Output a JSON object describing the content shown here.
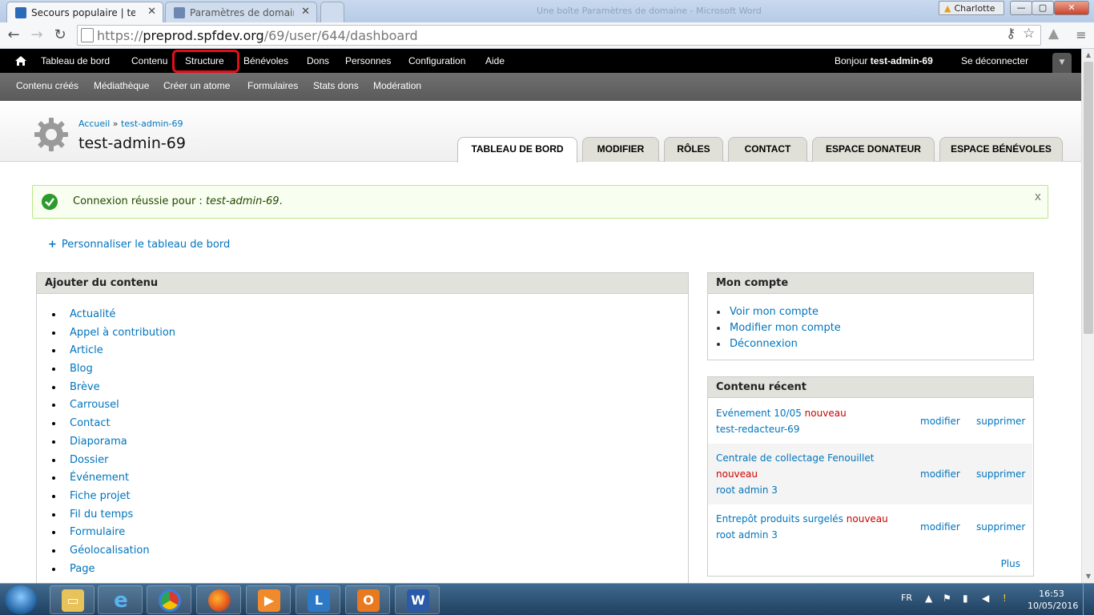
{
  "browser": {
    "tabs": [
      {
        "title": "Secours populaire | test-a",
        "active": true
      },
      {
        "title": "Paramètres de domaine",
        "active": false
      }
    ],
    "window_title_faded": "Une boîte Paramètres de domaine - Microsoft Word",
    "profile_name": "Charlotte",
    "window_buttons": {
      "minimize": "—",
      "maximize": "▢",
      "close": "✕"
    },
    "url": {
      "scheme": "https://",
      "host": "preprod.spfdev.org",
      "path": "/69/user/644/dashboard"
    },
    "nav": {
      "back": "←",
      "forward": "→",
      "reload": "↻"
    }
  },
  "admin_toolbar": {
    "items": [
      "Tableau de bord",
      "Contenu",
      "Structure",
      "Bénévoles",
      "Dons",
      "Personnes",
      "Configuration",
      "Aide"
    ],
    "highlighted": "Structure",
    "greeting_prefix": "Bonjour",
    "username": "test-admin-69",
    "logout": "Se déconnecter"
  },
  "shortcuts": [
    "Contenu créés",
    "Médiathèque",
    "Créer un atome",
    "Formulaires",
    "Stats dons",
    "Modération"
  ],
  "header": {
    "breadcrumb": {
      "home": "Accueil",
      "separator": "»",
      "current": "test-admin-69"
    },
    "title": "test-admin-69",
    "tabs": [
      "Tableau de bord",
      "Modifier",
      "Rôles",
      "Contact",
      "Espace donateur",
      "Espace bénévoles"
    ],
    "active_tab": "Tableau de bord"
  },
  "message": {
    "text": "Connexion réussie pour : ",
    "user": "test-admin-69",
    "end": ".",
    "close": "x"
  },
  "personalize": {
    "icon": "+",
    "label": "Personnaliser le tableau de bord"
  },
  "add_content": {
    "title": "Ajouter du contenu",
    "items": [
      "Actualité",
      "Appel à contribution",
      "Article",
      "Blog",
      "Brève",
      "Carrousel",
      "Contact",
      "Diaporama",
      "Dossier",
      "Événement",
      "Fiche projet",
      "Fil du temps",
      "Formulaire",
      "Géolocalisation",
      "Page"
    ]
  },
  "my_account": {
    "title": "Mon compte",
    "items": [
      "Voir mon compte",
      "Modifier mon compte",
      "Déconnexion"
    ]
  },
  "recent_content": {
    "title": "Contenu récent",
    "new_label": "nouveau",
    "edit_label": "modifier",
    "delete_label": "supprimer",
    "rows": [
      {
        "title": "Evénement 10/05",
        "author": "test-redacteur-69"
      },
      {
        "title": "Centrale de collectage Fenouillet",
        "author": "root admin 3"
      },
      {
        "title": "Entrepôt produits surgelés",
        "author": "root admin 3"
      }
    ],
    "more": "Plus"
  },
  "taskbar": {
    "apps": [
      "explorer",
      "internet-explorer",
      "chrome",
      "firefox",
      "media-player",
      "lync",
      "outlook",
      "word"
    ],
    "language": "FR",
    "time": "16:53",
    "date": "10/05/2016"
  },
  "colors": {
    "link": "#0074bd",
    "new": "#cc0000",
    "admin_bar": "#000000",
    "highlight": "#e0101a"
  }
}
